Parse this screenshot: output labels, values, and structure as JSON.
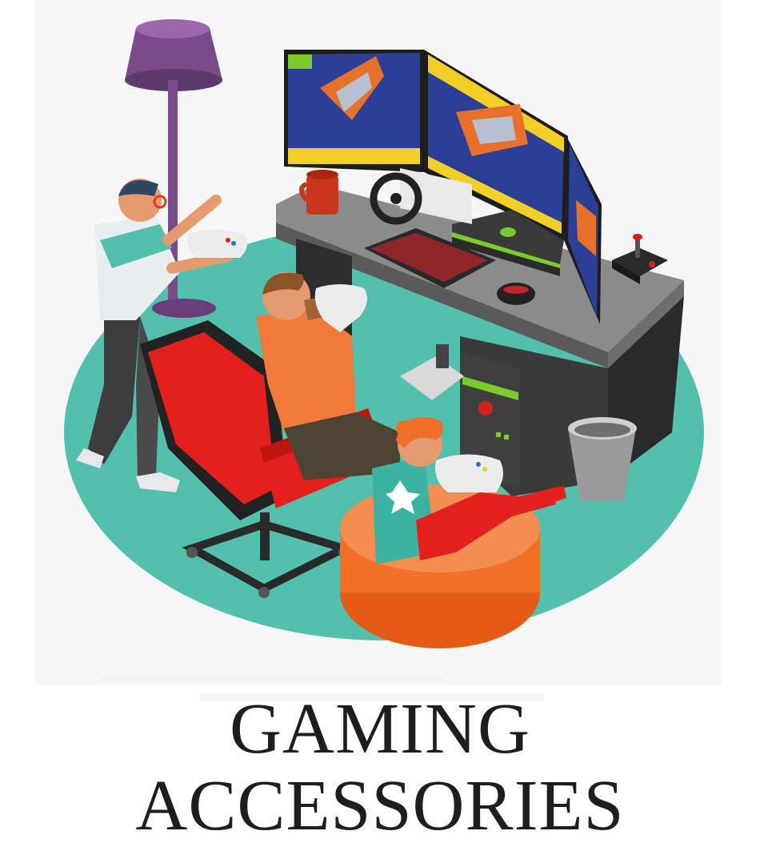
{
  "title": {
    "line1": "GAMING",
    "line2": "ACCESSORIES"
  },
  "illustration": {
    "name": "isometric gaming room",
    "colors": {
      "rug": "#53c0ae",
      "desk": "#8a8a8a",
      "desk_dark": "#3a3a3a",
      "screen_bg": "#2c3f97",
      "screen_frame": "#1d1d1d",
      "accent_yellow": "#f2cf27",
      "chair_red": "#e3201b",
      "pouf_orange": "#f07028",
      "lamp_purple": "#7a4a8a"
    }
  }
}
